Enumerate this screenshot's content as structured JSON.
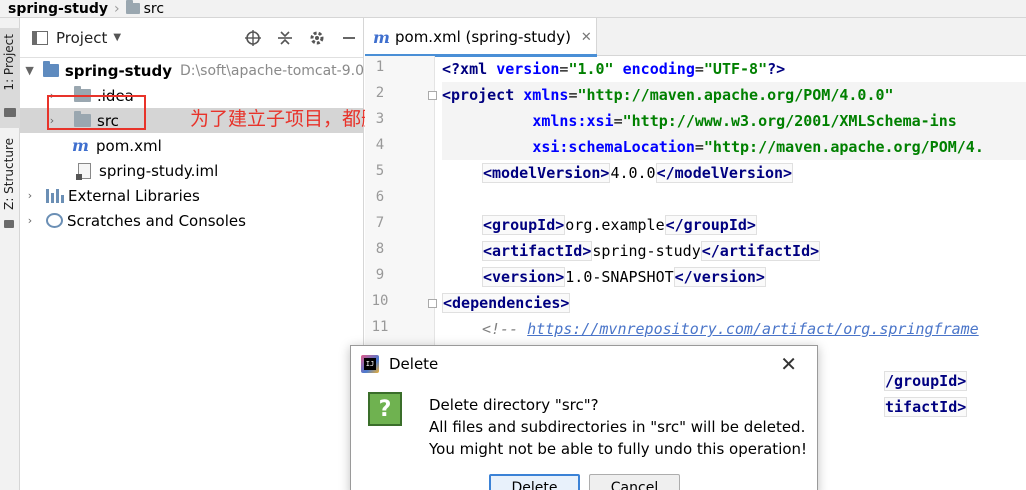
{
  "breadcrumb": {
    "project": "spring-study",
    "folder": "src"
  },
  "toolstrip": {
    "project_tab": "1: Project",
    "structure_tab": "Z: Structure"
  },
  "project_panel": {
    "title": "Project",
    "tree": [
      {
        "label": "spring-study",
        "path": "D:\\soft\\apache-tomcat-9.0"
      },
      {
        "label": ".idea"
      },
      {
        "label": "src"
      },
      {
        "label": "pom.xml"
      },
      {
        "label": "spring-study.iml"
      },
      {
        "label": "External Libraries"
      },
      {
        "label": "Scratches and Consoles"
      }
    ]
  },
  "annotation": "为了建立子项目，都删掉",
  "editor": {
    "tab_label": "pom.xml (spring-study)",
    "line_numbers": [
      "1",
      "2",
      "3",
      "4",
      "5",
      "6",
      "7",
      "8",
      "9",
      "10",
      "11"
    ],
    "code": {
      "l1_a": "<?xml ",
      "l1_b": "version",
      "l1_c": "=",
      "l1_d": "\"1.0\"",
      "l1_e": " encoding",
      "l1_f": "=",
      "l1_g": "\"UTF-8\"",
      "l1_h": "?>",
      "l2_a": "<project",
      "l2_b": " xmlns",
      "l2_c": "=",
      "l2_d": "\"http://maven.apache.org/POM/4.0.0\"",
      "l3_a": "xmlns:xsi",
      "l3_b": "=",
      "l3_c": "\"http://www.w3.org/2001/XMLSchema-ins",
      "l4_a": "xsi:schemaLocation",
      "l4_b": "=",
      "l4_c": "\"http://maven.apache.org/POM/4.",
      "l5_open": "<modelVersion>",
      "l5_val": "4.0.0",
      "l5_close": "</modelVersion>",
      "l7_open": "<groupId>",
      "l7_val": "org.example",
      "l7_close": "</groupId>",
      "l8_open": "<artifactId>",
      "l8_val": "spring-study",
      "l8_close": "</artifactId>",
      "l9_open": "<version>",
      "l9_val": "1.0-SNAPSHOT",
      "l9_close": "</version>",
      "l10": "<dependencies>",
      "l11_a": "<!-- ",
      "l11_b": "https://mvnrepository.com/artifact/org.springframe",
      "l12_tail": "/groupId>",
      "l13_tail": "tifactId>"
    }
  },
  "dialog": {
    "title": "Delete",
    "line1": "Delete directory \"src\"?",
    "line2": "All files and subdirectories in \"src\" will be deleted.",
    "line3": "You might not be able to fully undo this operation!",
    "delete_label": "Delete",
    "cancel_label": "Cancel"
  }
}
